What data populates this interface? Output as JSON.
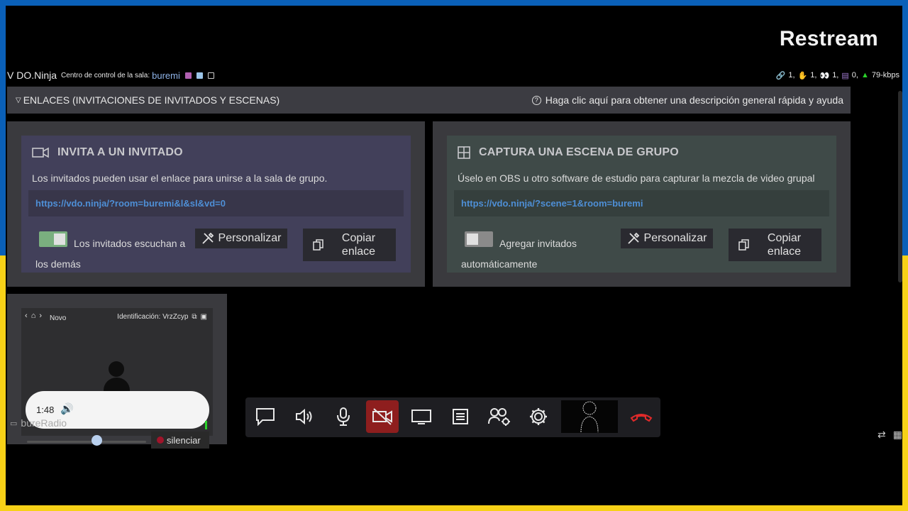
{
  "brand": "Restream",
  "topbar": {
    "logo": "V DO.Ninja",
    "room_label": "Centro de control de la sala:",
    "room_name": "buremi",
    "stats": {
      "links": "1,",
      "hands": "1,",
      "eyes": "1,",
      "stack": "0,",
      "bitrate": "79-kbps"
    }
  },
  "links_bar": {
    "title": "ENLACES (INVITACIONES DE INVITADOS Y ESCENAS)",
    "help": "Haga clic aquí para obtener una descripción general rápida y ayuda"
  },
  "invite": {
    "title": "INVITA A UN INVITADO",
    "desc": "Los invitados pueden usar el enlace para unirse a la sala de grupo.",
    "url": "https://vdo.ninja/?room=buremi&l&sl&vd=0",
    "toggle_label": "Los invitados escuchan a los demás",
    "toggle_on": true,
    "customize": "Personalizar",
    "copy": "Copiar enlace"
  },
  "scene": {
    "title": "CAPTURA UNA ESCENA DE GRUPO",
    "desc": "Úselo en OBS u otro software de estudio para capturar la mezcla de video grupal",
    "url": "https://vdo.ninja/?scene=1&room=buremi",
    "toggle_label": "Agregar invitados automáticamente",
    "toggle_on": false,
    "customize": "Personalizar",
    "copy": "Copiar enlace"
  },
  "guest": {
    "name": "Novo",
    "ident": "Identificación: VrzZcyp",
    "time": "1:48",
    "label": "bureRadio",
    "mute": "silenciar",
    "volume_fraction": 0.6
  },
  "colors": {
    "accent_blue": "#4e8fd6",
    "camera_off": "#8e1e1e",
    "toggle_on": "#7aaf7f"
  }
}
